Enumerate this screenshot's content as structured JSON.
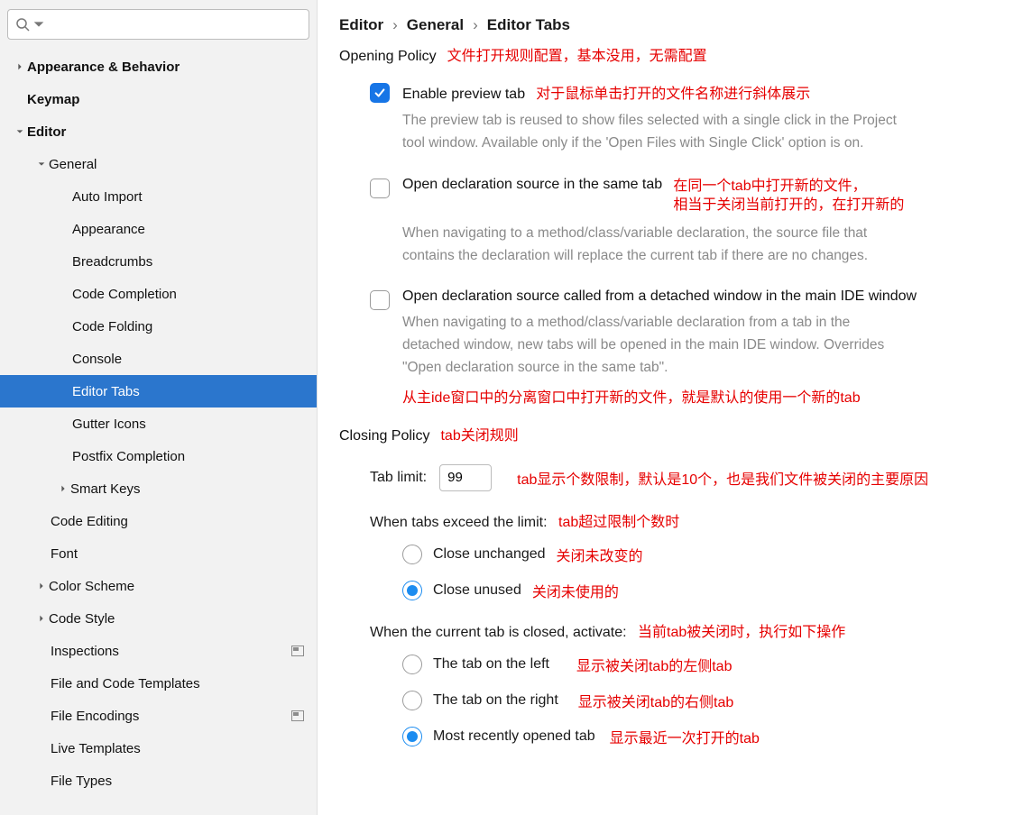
{
  "sidebar": {
    "search_placeholder": "",
    "items": [
      {
        "label": "Appearance & Behavior",
        "lvl": 0,
        "bold": true,
        "arrow": "right",
        "name": "appearance-behavior"
      },
      {
        "label": "Keymap",
        "lvl": 0,
        "bold": true,
        "arrow": "",
        "name": "keymap"
      },
      {
        "label": "Editor",
        "lvl": 0,
        "bold": true,
        "arrow": "down",
        "name": "editor"
      },
      {
        "label": "General",
        "lvl": 1,
        "bold": false,
        "arrow": "down",
        "name": "general"
      },
      {
        "label": "Auto Import",
        "lvl": 2,
        "bold": false,
        "arrow": "",
        "name": "auto-import"
      },
      {
        "label": "Appearance",
        "lvl": 2,
        "bold": false,
        "arrow": "",
        "name": "editor-appearance"
      },
      {
        "label": "Breadcrumbs",
        "lvl": 2,
        "bold": false,
        "arrow": "",
        "name": "breadcrumbs"
      },
      {
        "label": "Code Completion",
        "lvl": 2,
        "bold": false,
        "arrow": "",
        "name": "code-completion"
      },
      {
        "label": "Code Folding",
        "lvl": 2,
        "bold": false,
        "arrow": "",
        "name": "code-folding"
      },
      {
        "label": "Console",
        "lvl": 2,
        "bold": false,
        "arrow": "",
        "name": "console"
      },
      {
        "label": "Editor Tabs",
        "lvl": 2,
        "bold": false,
        "arrow": "",
        "name": "editor-tabs",
        "selected": true
      },
      {
        "label": "Gutter Icons",
        "lvl": 2,
        "bold": false,
        "arrow": "",
        "name": "gutter-icons"
      },
      {
        "label": "Postfix Completion",
        "lvl": 2,
        "bold": false,
        "arrow": "",
        "name": "postfix-completion"
      },
      {
        "label": "Smart Keys",
        "lvl": 2,
        "bold": false,
        "arrow": "right",
        "name": "smart-keys",
        "hasarrow": true
      },
      {
        "label": "Code Editing",
        "lvl": 1,
        "bold": false,
        "arrow": "",
        "name": "code-editing"
      },
      {
        "label": "Font",
        "lvl": 1,
        "bold": false,
        "arrow": "",
        "name": "font"
      },
      {
        "label": "Color Scheme",
        "lvl": 0,
        "bold": false,
        "arrow": "right",
        "name": "color-scheme",
        "indent1": true
      },
      {
        "label": "Code Style",
        "lvl": 0,
        "bold": false,
        "arrow": "right",
        "name": "code-style",
        "indent1": true
      },
      {
        "label": "Inspections",
        "lvl": 1,
        "bold": false,
        "arrow": "",
        "name": "inspections",
        "tag": true
      },
      {
        "label": "File and Code Templates",
        "lvl": 1,
        "bold": false,
        "arrow": "",
        "name": "file-code-templates"
      },
      {
        "label": "File Encodings",
        "lvl": 1,
        "bold": false,
        "arrow": "",
        "name": "file-encodings",
        "tag": true
      },
      {
        "label": "Live Templates",
        "lvl": 1,
        "bold": false,
        "arrow": "",
        "name": "live-templates"
      },
      {
        "label": "File Types",
        "lvl": 1,
        "bold": false,
        "arrow": "",
        "name": "file-types"
      }
    ]
  },
  "breadcrumb": {
    "a": "Editor",
    "b": "General",
    "c": "Editor Tabs"
  },
  "opening": {
    "title": "Opening Policy",
    "anno": "文件打开规则配置，基本没用，无需配置",
    "opt1": {
      "label": "Enable preview tab",
      "anno": "对于鼠标单击打开的文件名称进行斜体展示",
      "desc": "The preview tab is reused to show files selected with a single click in the Project tool window. Available only if the 'Open Files with Single Click' option is on."
    },
    "opt2": {
      "label": "Open declaration source in the same tab",
      "anno1": "在同一个tab中打开新的文件，",
      "anno2": "相当于关闭当前打开的，在打开新的",
      "desc": "When navigating to a method/class/variable declaration, the source file that contains the declaration will replace the current tab if there are no changes."
    },
    "opt3": {
      "label": "Open declaration source called from a detached window in the main IDE window",
      "desc": "When navigating to a method/class/variable declaration from a tab in the detached window, new tabs will be opened in the main IDE window. Overrides \"Open declaration source in the same tab\".",
      "below": "从主ide窗口中的分离窗口中打开新的文件，就是默认的使用一个新的tab"
    }
  },
  "closing": {
    "title": "Closing Policy",
    "anno": "tab关闭规则",
    "limit_label": "Tab limit:",
    "limit_value": "99",
    "limit_anno": "tab显示个数限制，默认是10个，也是我们文件被关闭的主要原因",
    "exceed_label": "When tabs exceed the limit:",
    "exceed_anno": "tab超过限制个数时",
    "r1": {
      "label": "Close unchanged",
      "anno": "关闭未改变的"
    },
    "r2": {
      "label": "Close unused",
      "anno": "关闭未使用的"
    },
    "closed_label": "When the current tab is closed, activate:",
    "closed_anno": "当前tab被关闭时，执行如下操作",
    "c1": {
      "label": "The tab on the left",
      "anno": "显示被关闭tab的左侧tab"
    },
    "c2": {
      "label": "The tab on the right",
      "anno": "显示被关闭tab的右侧tab"
    },
    "c3": {
      "label": "Most recently opened tab",
      "anno": "显示最近一次打开的tab"
    }
  }
}
